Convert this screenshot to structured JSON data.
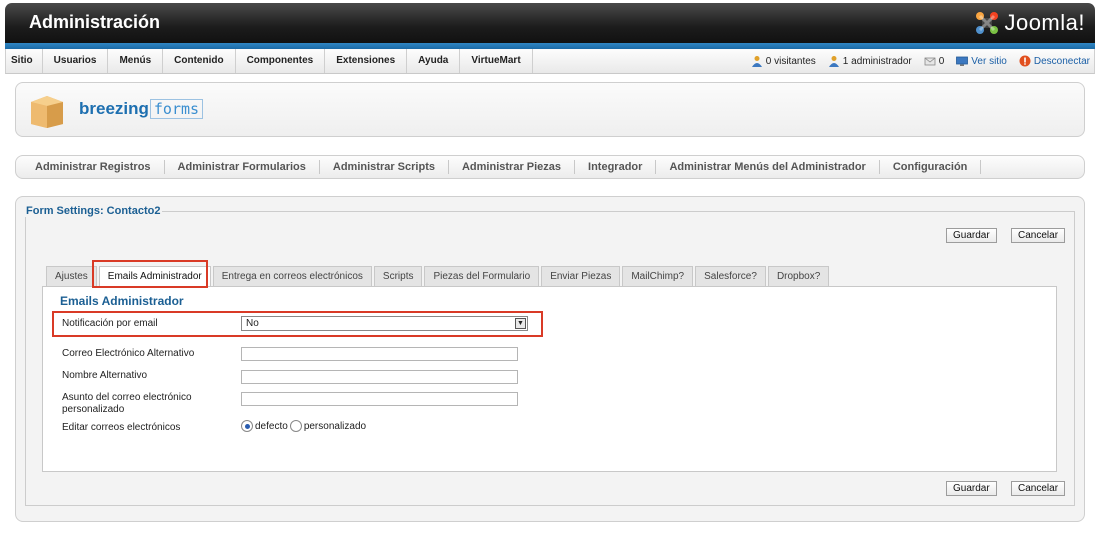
{
  "header": {
    "title": "Administración",
    "brand": "Joomla!"
  },
  "menubar": {
    "items": [
      "Sitio",
      "Usuarios",
      "Menús",
      "Contenido",
      "Componentes",
      "Extensiones",
      "Ayuda",
      "VirtueMart"
    ]
  },
  "status": {
    "visitors": "0 visitantes",
    "admins": "1 administrador",
    "messages": "0",
    "view_site": "Ver sitio",
    "logout": "Desconectar"
  },
  "component": {
    "logo_main": "breezing",
    "logo_sub": "forms"
  },
  "submenu": {
    "items": [
      "Administrar Registros",
      "Administrar Formularios",
      "Administrar Scripts",
      "Administrar Piezas",
      "Integrador",
      "Administrar Menús del Administrador",
      "Configuración"
    ]
  },
  "form": {
    "legend": "Form Settings: Contacto2",
    "save_label": "Guardar",
    "cancel_label": "Cancelar",
    "tabs": [
      "Ajustes",
      "Emails Administrador",
      "Entrega en correos electrónicos",
      "Scripts",
      "Piezas del Formulario",
      "Enviar Piezas",
      "MailChimp?",
      "Salesforce?",
      "Dropbox?"
    ],
    "active_tab": "Emails Administrador",
    "section_title": "Emails Administrador",
    "fields": {
      "notification_label": "Notificación por email",
      "notification_value": "No",
      "alt_email_label": "Correo Electrónico Alternativo",
      "alt_email_value": "",
      "alt_name_label": "Nombre Alternativo",
      "alt_name_value": "",
      "subject_label": "Asunto del correo electrónico personalizado",
      "subject_value": "",
      "edit_emails_label": "Editar correos electrónicos",
      "radio_default": "defecto",
      "radio_custom": "personalizado",
      "radio_selected": "defecto"
    }
  },
  "colors": {
    "header_bg": "#1c1c1c",
    "accent_blue": "#1b6aa5",
    "link_blue": "#1b5fa6",
    "highlight_red": "#d93a26",
    "legend_blue": "#1b5f93"
  }
}
